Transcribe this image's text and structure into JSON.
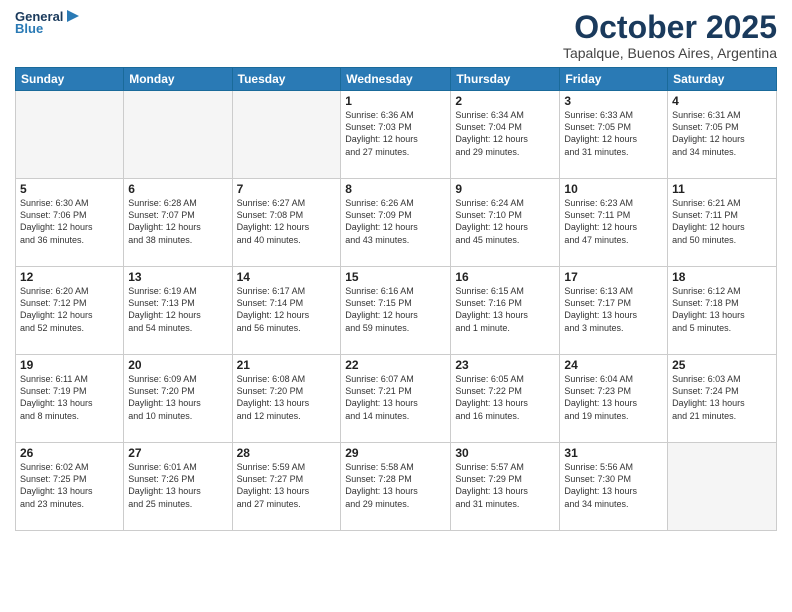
{
  "header": {
    "logo_general": "General",
    "logo_blue": "Blue",
    "month_title": "October 2025",
    "location": "Tapalque, Buenos Aires, Argentina"
  },
  "days_of_week": [
    "Sunday",
    "Monday",
    "Tuesday",
    "Wednesday",
    "Thursday",
    "Friday",
    "Saturday"
  ],
  "weeks": [
    [
      {
        "day": "",
        "detail": ""
      },
      {
        "day": "",
        "detail": ""
      },
      {
        "day": "",
        "detail": ""
      },
      {
        "day": "1",
        "detail": "Sunrise: 6:36 AM\nSunset: 7:03 PM\nDaylight: 12 hours\nand 27 minutes."
      },
      {
        "day": "2",
        "detail": "Sunrise: 6:34 AM\nSunset: 7:04 PM\nDaylight: 12 hours\nand 29 minutes."
      },
      {
        "day": "3",
        "detail": "Sunrise: 6:33 AM\nSunset: 7:05 PM\nDaylight: 12 hours\nand 31 minutes."
      },
      {
        "day": "4",
        "detail": "Sunrise: 6:31 AM\nSunset: 7:05 PM\nDaylight: 12 hours\nand 34 minutes."
      }
    ],
    [
      {
        "day": "5",
        "detail": "Sunrise: 6:30 AM\nSunset: 7:06 PM\nDaylight: 12 hours\nand 36 minutes."
      },
      {
        "day": "6",
        "detail": "Sunrise: 6:28 AM\nSunset: 7:07 PM\nDaylight: 12 hours\nand 38 minutes."
      },
      {
        "day": "7",
        "detail": "Sunrise: 6:27 AM\nSunset: 7:08 PM\nDaylight: 12 hours\nand 40 minutes."
      },
      {
        "day": "8",
        "detail": "Sunrise: 6:26 AM\nSunset: 7:09 PM\nDaylight: 12 hours\nand 43 minutes."
      },
      {
        "day": "9",
        "detail": "Sunrise: 6:24 AM\nSunset: 7:10 PM\nDaylight: 12 hours\nand 45 minutes."
      },
      {
        "day": "10",
        "detail": "Sunrise: 6:23 AM\nSunset: 7:11 PM\nDaylight: 12 hours\nand 47 minutes."
      },
      {
        "day": "11",
        "detail": "Sunrise: 6:21 AM\nSunset: 7:11 PM\nDaylight: 12 hours\nand 50 minutes."
      }
    ],
    [
      {
        "day": "12",
        "detail": "Sunrise: 6:20 AM\nSunset: 7:12 PM\nDaylight: 12 hours\nand 52 minutes."
      },
      {
        "day": "13",
        "detail": "Sunrise: 6:19 AM\nSunset: 7:13 PM\nDaylight: 12 hours\nand 54 minutes."
      },
      {
        "day": "14",
        "detail": "Sunrise: 6:17 AM\nSunset: 7:14 PM\nDaylight: 12 hours\nand 56 minutes."
      },
      {
        "day": "15",
        "detail": "Sunrise: 6:16 AM\nSunset: 7:15 PM\nDaylight: 12 hours\nand 59 minutes."
      },
      {
        "day": "16",
        "detail": "Sunrise: 6:15 AM\nSunset: 7:16 PM\nDaylight: 13 hours\nand 1 minute."
      },
      {
        "day": "17",
        "detail": "Sunrise: 6:13 AM\nSunset: 7:17 PM\nDaylight: 13 hours\nand 3 minutes."
      },
      {
        "day": "18",
        "detail": "Sunrise: 6:12 AM\nSunset: 7:18 PM\nDaylight: 13 hours\nand 5 minutes."
      }
    ],
    [
      {
        "day": "19",
        "detail": "Sunrise: 6:11 AM\nSunset: 7:19 PM\nDaylight: 13 hours\nand 8 minutes."
      },
      {
        "day": "20",
        "detail": "Sunrise: 6:09 AM\nSunset: 7:20 PM\nDaylight: 13 hours\nand 10 minutes."
      },
      {
        "day": "21",
        "detail": "Sunrise: 6:08 AM\nSunset: 7:20 PM\nDaylight: 13 hours\nand 12 minutes."
      },
      {
        "day": "22",
        "detail": "Sunrise: 6:07 AM\nSunset: 7:21 PM\nDaylight: 13 hours\nand 14 minutes."
      },
      {
        "day": "23",
        "detail": "Sunrise: 6:05 AM\nSunset: 7:22 PM\nDaylight: 13 hours\nand 16 minutes."
      },
      {
        "day": "24",
        "detail": "Sunrise: 6:04 AM\nSunset: 7:23 PM\nDaylight: 13 hours\nand 19 minutes."
      },
      {
        "day": "25",
        "detail": "Sunrise: 6:03 AM\nSunset: 7:24 PM\nDaylight: 13 hours\nand 21 minutes."
      }
    ],
    [
      {
        "day": "26",
        "detail": "Sunrise: 6:02 AM\nSunset: 7:25 PM\nDaylight: 13 hours\nand 23 minutes."
      },
      {
        "day": "27",
        "detail": "Sunrise: 6:01 AM\nSunset: 7:26 PM\nDaylight: 13 hours\nand 25 minutes."
      },
      {
        "day": "28",
        "detail": "Sunrise: 5:59 AM\nSunset: 7:27 PM\nDaylight: 13 hours\nand 27 minutes."
      },
      {
        "day": "29",
        "detail": "Sunrise: 5:58 AM\nSunset: 7:28 PM\nDaylight: 13 hours\nand 29 minutes."
      },
      {
        "day": "30",
        "detail": "Sunrise: 5:57 AM\nSunset: 7:29 PM\nDaylight: 13 hours\nand 31 minutes."
      },
      {
        "day": "31",
        "detail": "Sunrise: 5:56 AM\nSunset: 7:30 PM\nDaylight: 13 hours\nand 34 minutes."
      },
      {
        "day": "",
        "detail": ""
      }
    ]
  ]
}
